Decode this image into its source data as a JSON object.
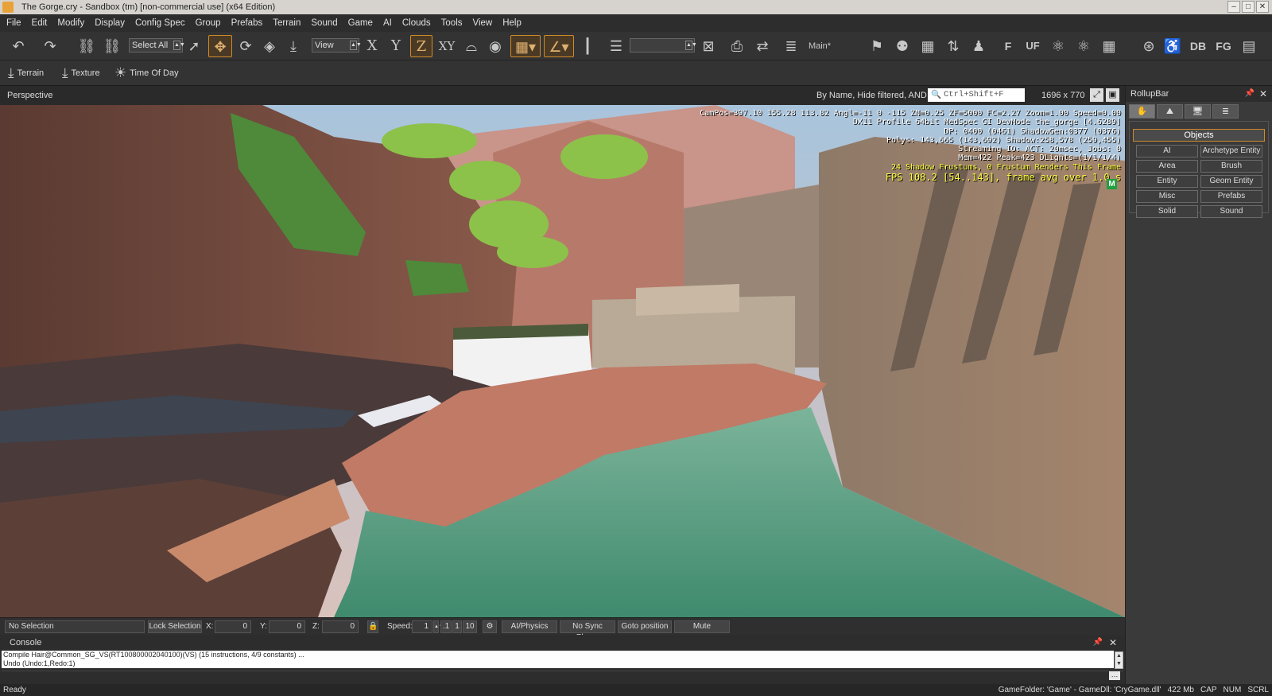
{
  "window": {
    "title": "The Gorge.cry - Sandbox (tm) [non-commercial use] (x64 Edition)",
    "controls": [
      "–",
      "□",
      "✕"
    ]
  },
  "menu": [
    "File",
    "Edit",
    "Modify",
    "Display",
    "Config Spec",
    "Group",
    "Prefabs",
    "Terrain",
    "Sound",
    "Game",
    "AI",
    "Clouds",
    "Tools",
    "View",
    "Help"
  ],
  "toolbar": {
    "select_mode": "Select All",
    "ref_coord": "View",
    "axis_x": "X",
    "axis_y": "Y",
    "axis_z": "Z",
    "axis_xy": "XY",
    "layer_name": "Main*",
    "icon_f": "F",
    "icon_uf": "UF",
    "icon_db": "DB",
    "icon_fg": "FG"
  },
  "toolbar2": [
    {
      "label": "Terrain",
      "icon": "terrain-icon"
    },
    {
      "label": "Texture",
      "icon": "texture-icon"
    },
    {
      "label": "Time Of Day",
      "icon": "sun-icon"
    }
  ],
  "viewport": {
    "name": "Perspective",
    "filter_text": "By Name, Hide filtered, AND",
    "search_placeholder": "Ctrl+Shift+F",
    "resolution": "1696 x 770",
    "hud": [
      "CamPos=397.10 155.28 113.82 Angl=-11  0 -115 ZN=0.25 ZF=5000 FC=2.27 Zoom=1.00 Speed=0.00",
      "DX11 Profile 64bit MedSpec GI DevMode the_gorge [4.6289]",
      "DP: 0400 (0461) ShadowGen:0377 (0376)",
      "Polys: 143,665 (143,692) Shadow:258,578 (259,455)",
      "Streaming IO: ACT: 20msec, Jobs: 0",
      "Mem=422 Peak=423 DLights=(1/1/1/4)"
    ],
    "hud_warning": "24 Shadow Frustums, 0 Frustum Renders This Frame",
    "hud_fps": "FPS 108.2 [54..143], frame avg over 1.0 s",
    "hud_badge": "M"
  },
  "rollup": {
    "title": "RollupBar",
    "section": "Objects",
    "buttons": [
      "AI",
      "Archetype Entity",
      "Area",
      "Brush",
      "Entity",
      "Geom Entity",
      "Misc",
      "Prefabs",
      "Solid",
      "Sound"
    ]
  },
  "statusbar": {
    "selection": "No Selection",
    "lock_selection": "Lock Selection",
    "x_label": "X:",
    "y_label": "Y:",
    "z_label": "Z:",
    "x_val": "0",
    "y_val": "0",
    "z_val": "0",
    "speed_label": "Speed:",
    "speed_val": "1",
    "speed_presets": [
      ".1",
      "1",
      "10"
    ],
    "ai_physics": "AI/Physics",
    "no_sync": "No Sync Player",
    "goto": "Goto position",
    "mute": "Mute"
  },
  "console": {
    "title": "Console",
    "lines": [
      "Compile Hair@Common_SG_VS(RT100800002040100)(VS) (15 instructions, 4/9 constants) ...",
      "Undo (Undo:1,Redo:1)"
    ]
  },
  "appstatus": {
    "ready": "Ready",
    "game_folder": "GameFolder: 'Game' - GameDll: 'CryGame.dll'",
    "memory": "422 Mb",
    "cap": "CAP",
    "num": "NUM",
    "scrl": "SCRL"
  }
}
